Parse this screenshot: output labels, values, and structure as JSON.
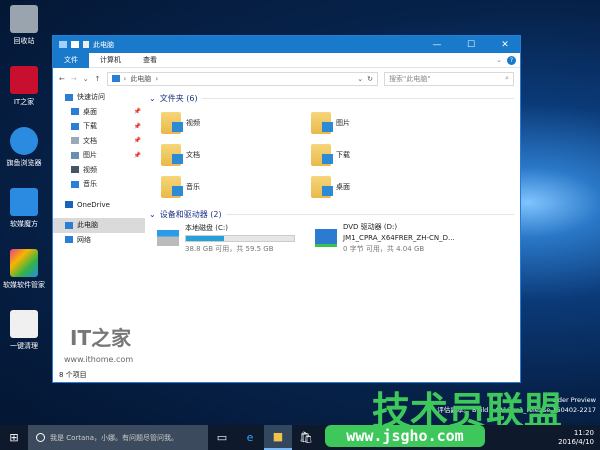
{
  "desktop": {
    "icons": [
      "回收站",
      "IT之家",
      "旗鱼浏览器",
      "软媒魔方",
      "软媒软件管家",
      "一键清理"
    ],
    "build_line1": "sider Preview",
    "build_line2": "评估副本。 Build 14316.rs1_release.160402-2217"
  },
  "window": {
    "title": "此电脑",
    "controls": {
      "min": "—",
      "max": "☐",
      "close": "✕"
    }
  },
  "ribbon": {
    "tabs": [
      "文件",
      "计算机",
      "查看"
    ]
  },
  "address": {
    "path": "此电脑",
    "search_placeholder": "搜索\"此电脑\""
  },
  "nav": {
    "items": [
      {
        "label": "快速访问",
        "pinned": false,
        "color": "#2a7fd4"
      },
      {
        "label": "桌面",
        "pinned": true,
        "color": "#2a7fd4"
      },
      {
        "label": "下载",
        "pinned": true,
        "color": "#2a7fd4"
      },
      {
        "label": "文档",
        "pinned": true,
        "color": "#9aa8b8"
      },
      {
        "label": "图片",
        "pinned": true,
        "color": "#6a8fb3"
      },
      {
        "label": "视频",
        "pinned": false,
        "color": "#445566"
      },
      {
        "label": "音乐",
        "pinned": false,
        "color": "#2a7fd4"
      },
      {
        "label": "OneDrive",
        "pinned": false,
        "color": "#1a64b8"
      },
      {
        "label": "此电脑",
        "pinned": false,
        "color": "#2a7fd4"
      },
      {
        "label": "网络",
        "pinned": false,
        "color": "#2a7fd4"
      }
    ]
  },
  "folders": {
    "header": "文件夹 (6)",
    "items": [
      "视频",
      "图片",
      "文档",
      "下载",
      "音乐",
      "桌面"
    ]
  },
  "drives": {
    "header": "设备和驱动器 (2)",
    "items": [
      {
        "name": "本地磁盘 (C:)",
        "sub": "",
        "space": "38.8 GB 可用，共 59.5 GB",
        "used_fraction": 0.35
      },
      {
        "name": "DVD 驱动器 (D:)",
        "sub": "JM1_CPRA_X64FRER_ZH-CN_D...",
        "space": "0 字节 可用，共 4.04 GB",
        "used_fraction": null
      }
    ]
  },
  "status": "8 个项目",
  "taskbar": {
    "cortana": "我是 Cortana，小娜。有问题尽管问我。",
    "time": "11:20",
    "date": "2016/4/10"
  },
  "watermarks": {
    "ithome": "IT之家",
    "ithome_url": "www.ithome.com",
    "jsgho": "技术员联盟",
    "jsgho_url": "www.jsgho.com"
  }
}
